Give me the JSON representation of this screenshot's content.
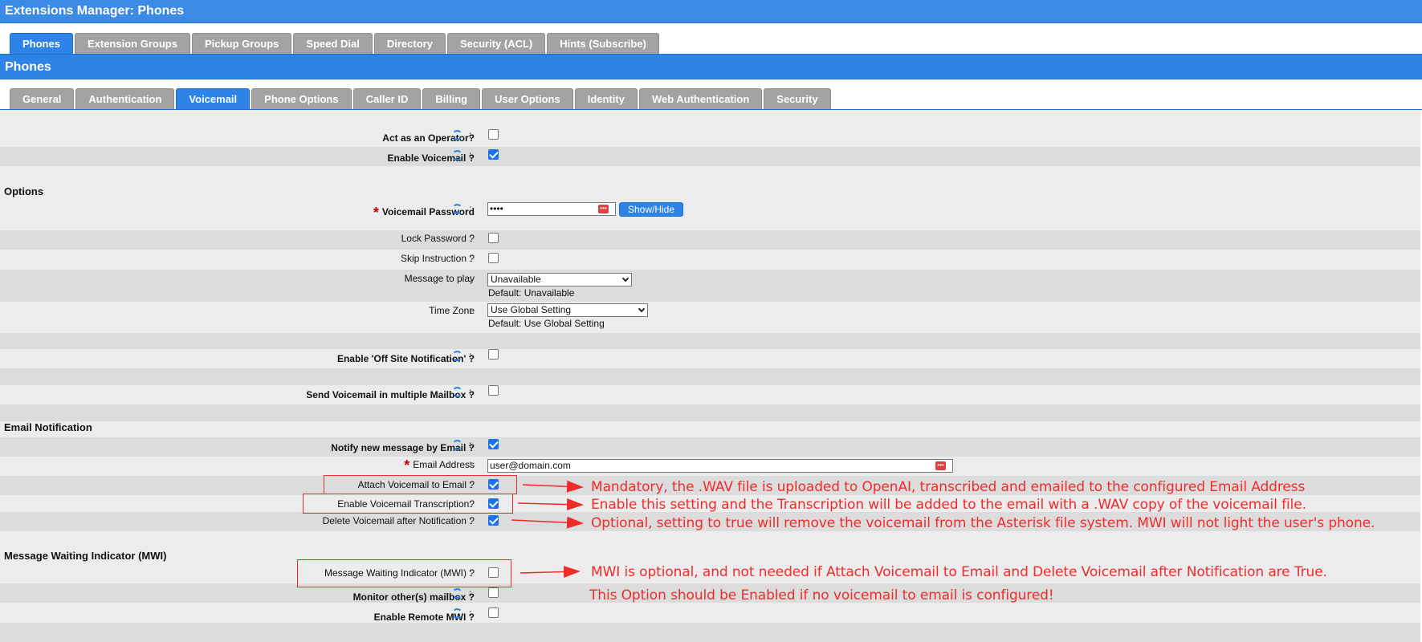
{
  "header": {
    "title": "Extensions Manager:  Phones"
  },
  "main_tabs": [
    {
      "label": "Phones",
      "active": true
    },
    {
      "label": "Extension Groups"
    },
    {
      "label": "Pickup Groups"
    },
    {
      "label": "Speed Dial"
    },
    {
      "label": "Directory"
    },
    {
      "label": "Security (ACL)"
    },
    {
      "label": "Hints (Subscribe)"
    }
  ],
  "section_header": {
    "title": "Phones"
  },
  "sub_tabs": [
    {
      "label": "General"
    },
    {
      "label": "Authentication"
    },
    {
      "label": "Voicemail",
      "active": true
    },
    {
      "label": "Phone Options"
    },
    {
      "label": "Caller ID"
    },
    {
      "label": "Billing"
    },
    {
      "label": "User Options"
    },
    {
      "label": "Identity"
    },
    {
      "label": "Web Authentication"
    },
    {
      "label": "Security"
    }
  ],
  "form": {
    "act_operator": {
      "label": "Act as an Operator?",
      "checked": false
    },
    "enable_voicemail": {
      "label": "Enable Voicemail ?",
      "checked": true
    },
    "options_title": "Options",
    "vm_password": {
      "label": "Voicemail Password",
      "value": "••••",
      "show_hide": "Show/Hide"
    },
    "lock_password": {
      "label": "Lock Password ?",
      "checked": false
    },
    "skip_instruction": {
      "label": "Skip Instruction ?",
      "checked": false
    },
    "message_to_play": {
      "label": "Message to play",
      "value": "Unavailable",
      "default": "Default: Unavailable"
    },
    "time_zone": {
      "label": "Time Zone",
      "value": "Use Global Setting",
      "default": "Default: Use Global Setting"
    },
    "offsite_notification": {
      "label": "Enable 'Off Site Notification' ?",
      "checked": false
    },
    "multiple_mailbox": {
      "label": "Send Voicemail in multiple Mailbox ?",
      "checked": false
    },
    "email_title": "Email Notification",
    "notify_email": {
      "label": "Notify new message by Email ?",
      "checked": true
    },
    "email_address": {
      "label": "Email Address",
      "value": "user@domain.com"
    },
    "attach_vm": {
      "label": "Attach Voicemail to Email ?",
      "checked": true
    },
    "transcription": {
      "label": "Enable Voicemail Transcription?",
      "checked": true
    },
    "delete_vm": {
      "label": "Delete Voicemail after Notification ?",
      "checked": true
    },
    "mwi_title": "Message Waiting Indicator (MWI)",
    "mwi": {
      "label": "Message Waiting Indicator (MWI) ?",
      "checked": false
    },
    "monitor_mailbox": {
      "label": "Monitor other(s) mailbox ?",
      "checked": false
    },
    "remote_mwi": {
      "label": "Enable Remote MWI ?",
      "checked": false
    },
    "colon": ":"
  },
  "annotations": {
    "attach_note": "Mandatory, the .WAV file is uploaded to OpenAI, transcribed and emailed to the configured Email Address",
    "transcription_note": "Enable this setting and the Transcription will be added to the email with a .WAV copy of the voicemail file.",
    "delete_note": "Optional, setting to true will remove the voicemail from the Asterisk file system. MWI will not light the user's phone.",
    "mwi_note": "MWI is optional, and not needed if Attach Voicemail to Email and Delete Voicemail after Notification are True.",
    "mwi_note2": "This Option should be Enabled if no voicemail to email is configured!",
    "color": "#ef2b2b"
  },
  "colors": {
    "accent": "#2e84e6",
    "tab_inactive": "#a3a3a3",
    "row_light": "#ececec",
    "row_dark": "#dcdcdc"
  }
}
